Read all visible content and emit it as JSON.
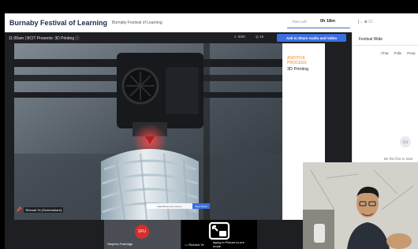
{
  "app": {
    "title": "Burnaby Festival of Learning",
    "subtitle": "Burnaby Festival of Learning"
  },
  "timer": {
    "label": "Time Left",
    "value": "0h 18m"
  },
  "top_icons": "[→  ⊕  ☐",
  "session": {
    "title": "11:00am | BCIT Presents: 3D Printing ⓘ",
    "attendees": "☺ 0/20",
    "viewers": "◎ 15",
    "share_button": "Ask to Share Audio and Video"
  },
  "slide": {
    "heading": "ADDITIVE PROCESS",
    "subheading": "3D Printing"
  },
  "presenter_tag": {
    "pin": "📌",
    "name": "Richard Ye (Screenshare)"
  },
  "screen_control": {
    "text": "Hide/Show your screen",
    "button": "Stop Share"
  },
  "participants": [
    {
      "name": "Stephen Partridge",
      "avatar": "SFU"
    },
    {
      "prefix": "•••",
      "name": "Richard Ye",
      "pip_message": "laying in Picture-in-ure mode"
    }
  ],
  "sidebar": {
    "header": "Festival Wide",
    "tabs": [
      "Chat",
      "Polls",
      "Peop"
    ],
    "empty_text": "Be the first to start"
  },
  "colors": {
    "brand_navy": "#1d2b4f",
    "accent_blue": "#3a6fe2",
    "slide_orange": "#e8892b",
    "avatar_red": "#d32f2f"
  }
}
